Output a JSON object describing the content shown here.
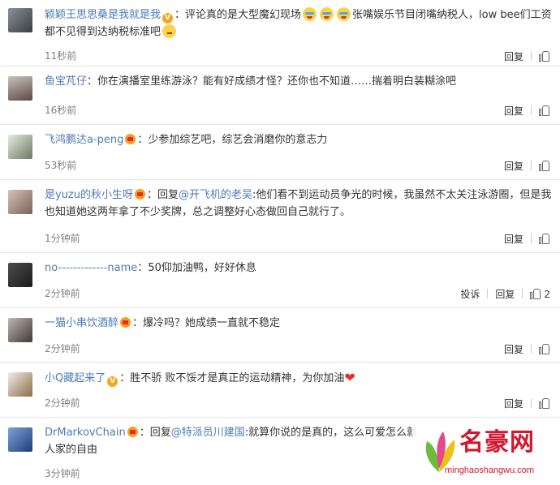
{
  "comments": [
    {
      "username": "颖颖王思思桑是我就是我",
      "badge": "vip",
      "text_a": "：评论真的是大型魔幻现场",
      "text_b": "张嘴娱乐节目闭嘴纳税人，low bee们工资都不见得到达纳税标准吧",
      "time": "11秒前",
      "reply": "回复",
      "emojis": [
        "crying-laughing-emoji",
        "crying-laughing-emoji",
        "crying-laughing-emoji",
        "thinking-emoji"
      ]
    },
    {
      "username": "鱼宝芃仔",
      "text": "：你在演播室里练游泳？能有好成绩才怪？还你也不知道……揣着明白装糊涂吧",
      "time": "16秒前",
      "reply": "回复"
    },
    {
      "username": "飞鸿鹏达a-peng",
      "badge": "crown",
      "text": "：少参加综艺吧，综艺会消磨你的意志力",
      "time": "53秒前",
      "reply": "回复"
    },
    {
      "username": "是yuzu的秋小生呀",
      "badge": "crown",
      "prefix": "：回复",
      "reply_to": "@开飞机的老吴",
      "text": ":他们看不到运动员争光的时候，我虽然不太关注泳游圈，但是我也知道她这两年拿了不少奖牌，总之调整好心态做回自己就行了。",
      "time": "1分钟前",
      "reply": "回复"
    },
    {
      "username": "no-------------name",
      "text": "：50仰加油鸭，好好休息",
      "time": "2分钟前",
      "report": "投诉",
      "reply": "回复",
      "likes": "2"
    },
    {
      "username": "一猫小串饮酒醉",
      "badge": "crown",
      "text": "：爆冷吗？她成绩一直就不稳定",
      "time": "2分钟前",
      "reply": "回复"
    },
    {
      "username": "小Q藏起来了",
      "badge": "vip",
      "text": "：胜不骄 败不馁才是真正的运动精神，为你加油",
      "time": "2分钟前",
      "reply": "回复",
      "emoji": "red-heart-emoji"
    },
    {
      "username": "DrMarkovChain",
      "badge": "crown",
      "prefix": "：回复",
      "reply_to": "@特派员川建国",
      "text": ":就算你说的是真的，这么可爱怎么就",
      "text_b": "人家的自由",
      "time": "3分钟前"
    }
  ],
  "watermark": {
    "title": "名豪网",
    "url": "minghaoshangwu.com"
  },
  "colors": {
    "username": "#4c7ab8",
    "watermark": "#d0182f",
    "meta": "#808080"
  }
}
